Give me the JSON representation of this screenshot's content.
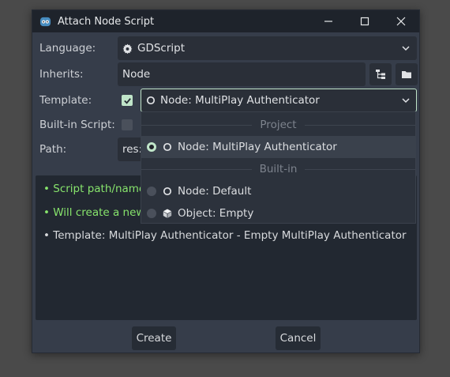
{
  "window": {
    "title": "Attach Node Script"
  },
  "form": {
    "language_label": "Language:",
    "language_value": "GDScript",
    "inherits_label": "Inherits:",
    "inherits_value": "Node",
    "template_label": "Template:",
    "template_value": "Node: MultiPlay Authenticator",
    "builtin_label": "Built-in Script:",
    "path_label": "Path:",
    "path_value": "res:"
  },
  "messages": [
    {
      "text": "• Script path/name",
      "status": "ok"
    },
    {
      "text": "• Will create a new",
      "status": "ok"
    },
    {
      "text": "• Template: MultiPlay Authenticator - Empty MultiPlay Authenticator",
      "status": "info"
    }
  ],
  "buttons": {
    "create": "Create",
    "cancel": "Cancel"
  },
  "dropdown": {
    "section_project": "Project",
    "section_builtin": "Built-in",
    "items": [
      {
        "label": "Node: MultiPlay Authenticator",
        "selected": true,
        "icon": "node-circle-icon"
      },
      {
        "label": "Node: Default",
        "selected": false,
        "icon": "node-circle-icon"
      },
      {
        "label": "Object: Empty",
        "selected": false,
        "icon": "object-cube-icon"
      }
    ]
  },
  "colors": {
    "accent": "#c0e5c9",
    "ok_text": "#87e46c",
    "window_bg": "#363d4a",
    "titlebar_bg": "#1e232b"
  }
}
